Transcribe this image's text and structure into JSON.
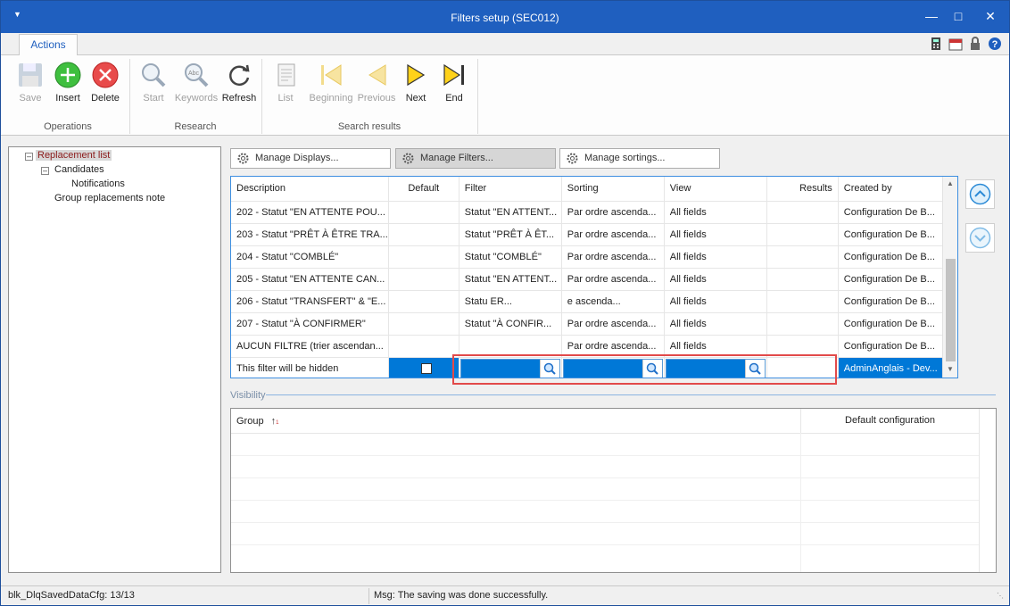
{
  "window": {
    "title": "Filters setup (SEC012)"
  },
  "ribbon": {
    "tab": "Actions",
    "buttons": {
      "save": "Save",
      "insert": "Insert",
      "delete": "Delete",
      "start": "Start",
      "keywords": "Keywords",
      "refresh": "Refresh",
      "list": "List",
      "beginning": "Beginning",
      "previous": "Previous",
      "next": "Next",
      "end": "End"
    },
    "groups": {
      "operations": "Operations",
      "research": "Research",
      "search_results": "Search results"
    }
  },
  "tree": {
    "root": "Replacement list",
    "candidates": "Candidates",
    "notifications": "Notifications",
    "group_note": "Group replacements note"
  },
  "manage": {
    "displays": "Manage Displays...",
    "filters": "Manage Filters...",
    "sortings": "Manage sortings..."
  },
  "grid": {
    "columns": [
      "Description",
      "Default",
      "Filter",
      "Sorting",
      "View",
      "Results",
      "Created by"
    ],
    "rows": [
      [
        "202 - Statut \"EN ATTENTE POU...",
        "",
        "Statut \"EN ATTENT...",
        "Par ordre ascenda...",
        "All fields",
        "",
        "Configuration De B..."
      ],
      [
        "203 - Statut \"PRÊT À ÊTRE TRA...",
        "",
        "Statut \"PRÊT À ÊT...",
        "Par ordre ascenda...",
        "All fields",
        "",
        "Configuration De B..."
      ],
      [
        "204 - Statut \"COMBLÉ\"",
        "",
        "Statut \"COMBLÉ\"",
        "Par ordre ascenda...",
        "All fields",
        "",
        "Configuration De B..."
      ],
      [
        "205 - Statut \"EN ATTENTE CAN...",
        "",
        "Statut \"EN ATTENT...",
        "Par ordre ascenda...",
        "All fields",
        "",
        "Configuration De B..."
      ],
      [
        "206 - Statut \"TRANSFERT\" & \"E...",
        "",
        "Statu                ER...",
        "                 e ascenda...",
        "All fields",
        "",
        "Configuration De B..."
      ],
      [
        "207 - Statut \"À CONFIRMER\"",
        "",
        "Statut \"À CONFIR...",
        "Par ordre ascenda...",
        "All fields",
        "",
        "Configuration De B..."
      ],
      [
        "AUCUN FILTRE (trier ascendan...",
        "",
        "",
        "Par ordre ascenda...",
        "All fields",
        "",
        "Configuration De B..."
      ]
    ],
    "selected_row": {
      "description": "This filter will be hidden",
      "created_by": "AdminAnglais - Dev..."
    }
  },
  "visibility": {
    "label": "Visibility",
    "col_group": "Group",
    "col_default": "Default configuration"
  },
  "status": {
    "left": "blk_DlqSavedDataCfg: 13/13",
    "message": "Msg: The saving was done successfully."
  },
  "colors": {
    "title_bar": "#1f5fbf",
    "selection": "#0078d7",
    "highlight": "#e24a4a"
  }
}
